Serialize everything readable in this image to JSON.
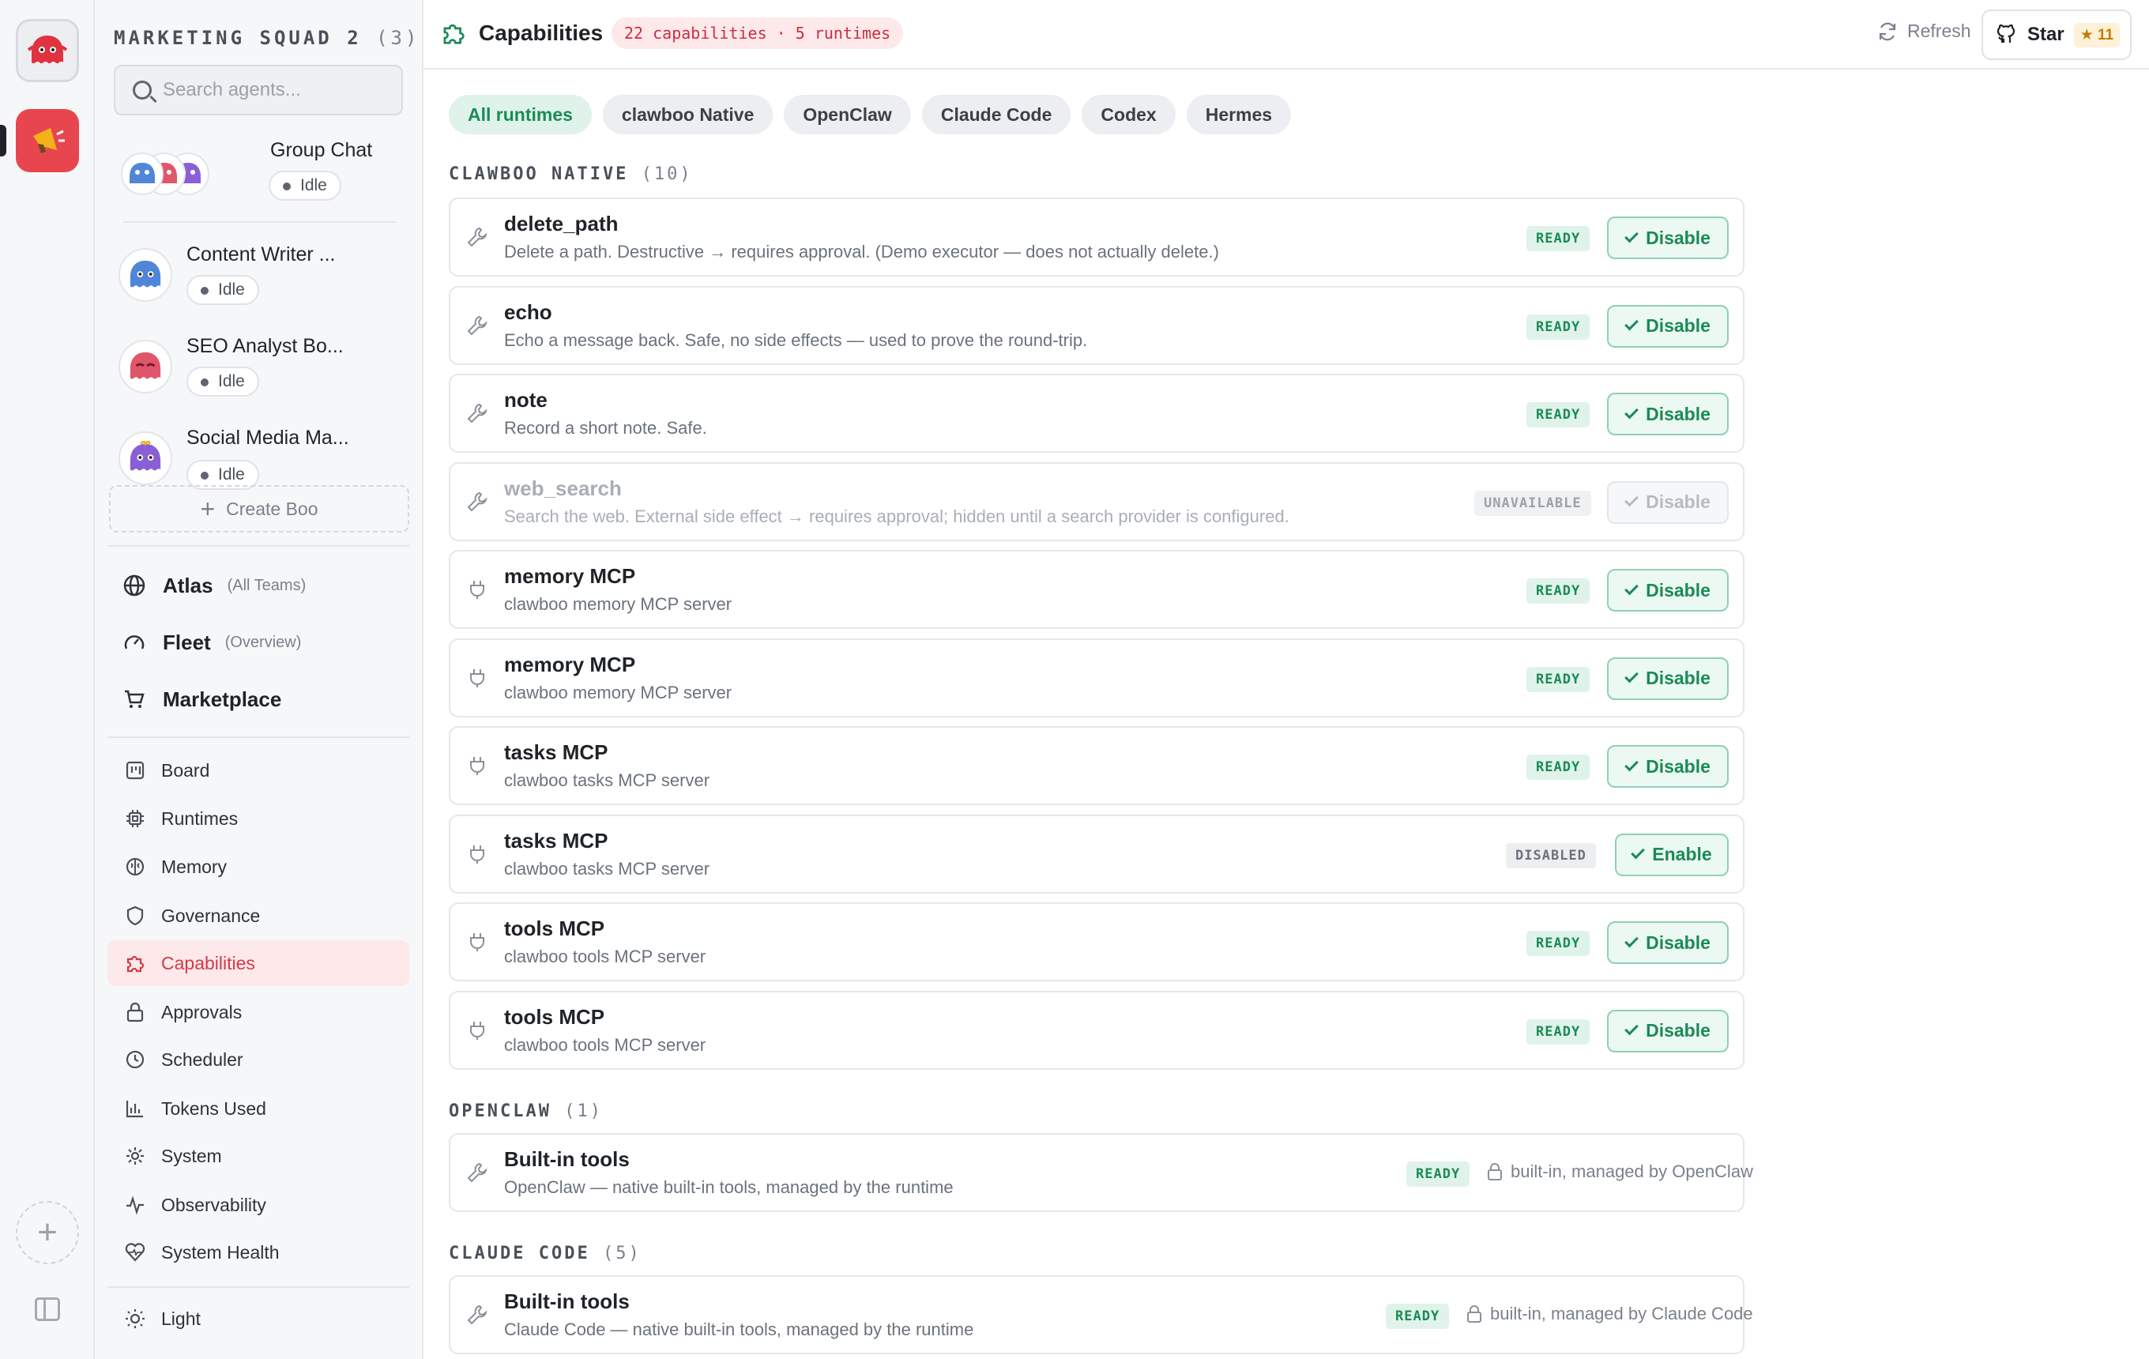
{
  "squad": {
    "name": "MARKETING SQUAD 2",
    "count": "(3)"
  },
  "search": {
    "placeholder": "Search agents..."
  },
  "group_chat": {
    "name": "Group Chat",
    "status": "Idle"
  },
  "agents": [
    {
      "name": "Content Writer ...",
      "status": "Idle",
      "color": "#4f86d9"
    },
    {
      "name": "SEO Analyst Bo...",
      "status": "Idle",
      "color": "#e0566a"
    },
    {
      "name": "Social Media Ma...",
      "status": "Idle",
      "color": "#8a5fd6"
    }
  ],
  "create_boo": "Create Boo",
  "nav_main": [
    {
      "label": "Atlas",
      "sub": "(All Teams)"
    },
    {
      "label": "Fleet",
      "sub": "(Overview)"
    },
    {
      "label": "Marketplace",
      "sub": ""
    }
  ],
  "nav": [
    {
      "label": "Board"
    },
    {
      "label": "Runtimes"
    },
    {
      "label": "Memory"
    },
    {
      "label": "Governance"
    },
    {
      "label": "Capabilities"
    },
    {
      "label": "Approvals"
    },
    {
      "label": "Scheduler"
    },
    {
      "label": "Tokens Used"
    },
    {
      "label": "System"
    },
    {
      "label": "Observability"
    },
    {
      "label": "System Health"
    }
  ],
  "theme_toggle": "Light",
  "header": {
    "title": "Capabilities",
    "badge": "22 capabilities · 5 runtimes",
    "refresh": "Refresh",
    "star": "Star",
    "star_count": "11"
  },
  "filters": [
    "All runtimes",
    "clawboo Native",
    "OpenClaw",
    "Claude Code",
    "Codex",
    "Hermes"
  ],
  "sections": {
    "native": {
      "title": "CLAWBOO NATIVE",
      "count": "(10)"
    },
    "openclaw": {
      "title": "OPENCLAW",
      "count": "(1)"
    },
    "claude": {
      "title": "CLAUDE CODE",
      "count": "(5)"
    }
  },
  "native_caps": [
    {
      "name": "delete_path",
      "desc": "Delete a path. Destructive → requires approval. (Demo executor — does not actually delete.)",
      "status": "READY",
      "action": "Disable",
      "icon": "wrench-icon"
    },
    {
      "name": "echo",
      "desc": "Echo a message back. Safe, no side effects — used to prove the round-trip.",
      "status": "READY",
      "action": "Disable",
      "icon": "wrench-icon"
    },
    {
      "name": "note",
      "desc": "Record a short note. Safe.",
      "status": "READY",
      "action": "Disable",
      "icon": "wrench-icon"
    },
    {
      "name": "web_search",
      "desc": "Search the web. External side effect → requires approval; hidden until a search provider is configured.",
      "status": "UNAVAILABLE",
      "action": "Disable",
      "icon": "wrench-icon"
    },
    {
      "name": "memory MCP",
      "desc": "clawboo memory MCP server",
      "status": "READY",
      "action": "Disable",
      "icon": "plug-icon"
    },
    {
      "name": "memory MCP",
      "desc": "clawboo memory MCP server",
      "status": "READY",
      "action": "Disable",
      "icon": "plug-icon"
    },
    {
      "name": "tasks MCP",
      "desc": "clawboo tasks MCP server",
      "status": "READY",
      "action": "Disable",
      "icon": "plug-icon"
    },
    {
      "name": "tasks MCP",
      "desc": "clawboo tasks MCP server",
      "status": "DISABLED",
      "action": "Enable",
      "icon": "plug-icon"
    },
    {
      "name": "tools MCP",
      "desc": "clawboo tools MCP server",
      "status": "READY",
      "action": "Disable",
      "icon": "plug-icon"
    },
    {
      "name": "tools MCP",
      "desc": "clawboo tools MCP server",
      "status": "READY",
      "action": "Disable",
      "icon": "plug-icon"
    }
  ],
  "openclaw_caps": [
    {
      "name": "Built-in tools",
      "desc": "OpenClaw — native built-in tools, managed by the runtime",
      "status": "READY",
      "managed": "built-in, managed by OpenClaw"
    }
  ],
  "claude_caps": [
    {
      "name": "Built-in tools",
      "desc": "Claude Code — native built-in tools, managed by the runtime",
      "status": "READY",
      "managed": "built-in, managed by Claude Code"
    }
  ],
  "colors": {
    "accent": "#e8464e",
    "ready": "#1b8a57",
    "active_nav": "#d43a47"
  }
}
